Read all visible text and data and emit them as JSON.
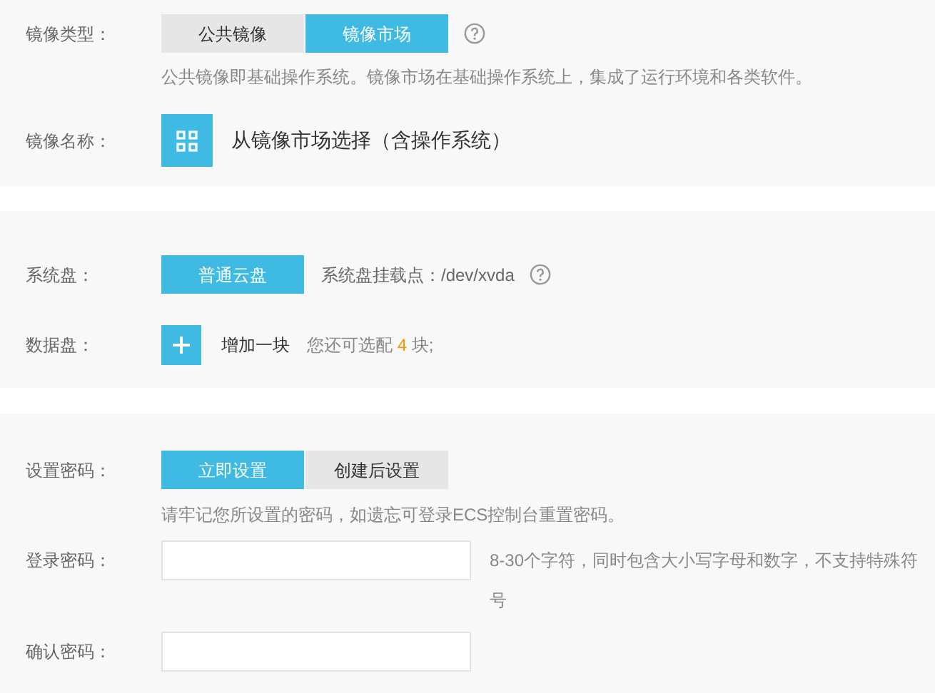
{
  "image_section": {
    "type_label": "镜像类型：",
    "type_options": [
      {
        "label": "公共镜像",
        "selected": false
      },
      {
        "label": "镜像市场",
        "selected": true
      }
    ],
    "type_description": "公共镜像即基础操作系统。镜像市场在基础操作系统上，集成了运行环境和各类软件。",
    "name_label": "镜像名称：",
    "name_action": "从镜像市场选择（含操作系统）"
  },
  "storage_section": {
    "system_disk_label": "系统盘：",
    "system_disk_options": [
      {
        "label": "普通云盘",
        "selected": true
      }
    ],
    "mount_point": "系统盘挂载点：/dev/xvda",
    "data_disk_label": "数据盘：",
    "add_disk_button": "增加一块",
    "remaining_prefix": "您还可选配",
    "remaining_count": "4",
    "remaining_suffix": "块;"
  },
  "password_section": {
    "set_label": "设置密码：",
    "set_options": [
      {
        "label": "立即设置",
        "selected": true
      },
      {
        "label": "创建后设置",
        "selected": false
      }
    ],
    "set_description": "请牢记您所设置的密码，如遗忘可登录ECS控制台重置密码。",
    "login_label": "登录密码：",
    "login_hint": "8-30个字符，同时包含大小写字母和数字，不支持特殊符号",
    "confirm_label": "确认密码："
  }
}
